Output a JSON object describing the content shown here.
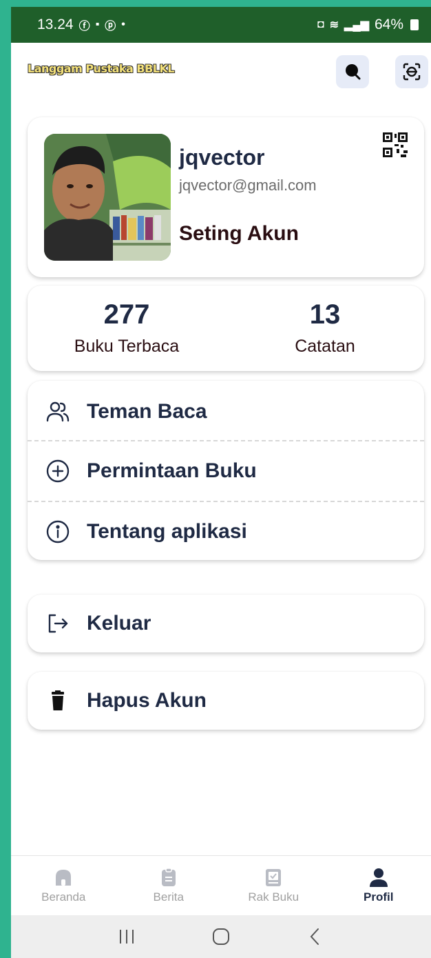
{
  "status_bar": {
    "time": "13.24",
    "battery": "64%"
  },
  "app_bar": {
    "title": "Langgam Pustaka BBLKL",
    "search_icon": "search-icon",
    "scan_icon": "face-scan-icon"
  },
  "profile": {
    "username": "jqvector",
    "email": "jqvector@gmail.com",
    "setting_label": "Seting Akun",
    "qr_icon": "qr-code-icon"
  },
  "stats": [
    {
      "value": "277",
      "label": "Buku Terbaca"
    },
    {
      "value": "13",
      "label": "Catatan"
    }
  ],
  "menu": [
    {
      "icon": "users-icon",
      "label": "Teman Baca"
    },
    {
      "icon": "plus-circle-icon",
      "label": "Permintaan Buku"
    },
    {
      "icon": "info-icon",
      "label": "Tentang aplikasi"
    }
  ],
  "logout": {
    "icon": "logout-icon",
    "label": "Keluar"
  },
  "delete_account": {
    "icon": "trash-icon",
    "label": "Hapus Akun"
  },
  "bottom_nav": [
    {
      "icon": "home-icon",
      "label": "Beranda",
      "active": false
    },
    {
      "icon": "clipboard-icon",
      "label": "Berita",
      "active": false
    },
    {
      "icon": "book-shelf-icon",
      "label": "Rak Buku",
      "active": false
    },
    {
      "icon": "user-icon",
      "label": "Profil",
      "active": true
    }
  ],
  "colors": {
    "frame": "#2fb38f",
    "status_bar": "#1f5f2a",
    "text_primary": "#1f2a44",
    "icon_button_bg": "#e6ebf7"
  }
}
